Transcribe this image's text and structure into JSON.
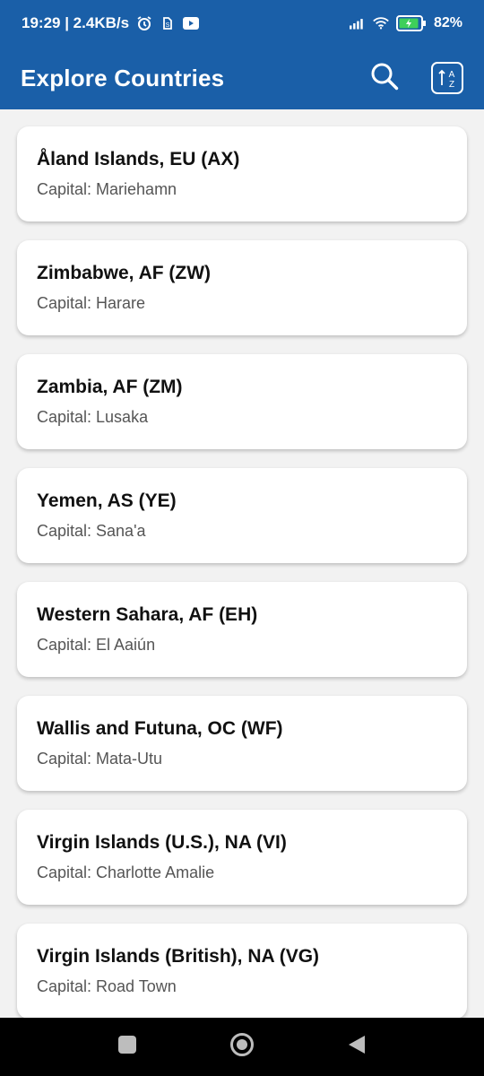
{
  "status": {
    "time_net": "19:29 | 2.4KB/s",
    "battery": "82%",
    "icons": [
      "alarm-icon",
      "sim-icon",
      "youtube-icon",
      "signal-icon",
      "wifi-icon",
      "battery-icon"
    ]
  },
  "appbar": {
    "title": "Explore Countries",
    "search_icon": "search-icon",
    "sort_icon": "sort-az-icon"
  },
  "countries": [
    {
      "name": "Åland Islands, EU (AX)",
      "capital": "Capital: Mariehamn"
    },
    {
      "name": "Zimbabwe, AF (ZW)",
      "capital": "Capital: Harare"
    },
    {
      "name": "Zambia, AF (ZM)",
      "capital": "Capital: Lusaka"
    },
    {
      "name": "Yemen, AS (YE)",
      "capital": "Capital: Sana'a"
    },
    {
      "name": "Western Sahara, AF (EH)",
      "capital": "Capital: El Aaiún"
    },
    {
      "name": "Wallis and Futuna, OC (WF)",
      "capital": "Capital: Mata-Utu"
    },
    {
      "name": "Virgin Islands (U.S.), NA (VI)",
      "capital": "Capital: Charlotte Amalie"
    },
    {
      "name": "Virgin Islands (British), NA (VG)",
      "capital": "Capital: Road Town"
    }
  ],
  "colors": {
    "primary": "#1a5fa8",
    "background": "#f2f2f2",
    "card": "#ffffff"
  }
}
